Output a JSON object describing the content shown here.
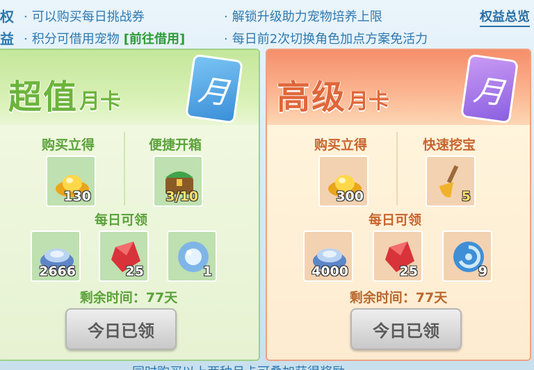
{
  "top": {
    "edge": [
      "权",
      "益"
    ],
    "perks": [
      "可以购买每日挑战券",
      "解锁升级助力宠物培养上限",
      "积分可借用宠物",
      "每日前2次切换角色加点方案免活力"
    ],
    "borrow_link": "[前往借用]",
    "summary_link": "权益总览"
  },
  "cards": [
    {
      "title_big": "超值",
      "title_small": "月卡",
      "emblem_glyph": "月",
      "section_left": "购买立得",
      "section_right": "便捷开箱",
      "instant": [
        {
          "icon": "gold-ingot-icon",
          "qty": "130"
        }
      ],
      "bonus": [
        {
          "icon": "treasure-chest-icon",
          "qty": "3/10"
        }
      ],
      "daily_title": "每日可领",
      "daily": [
        {
          "icon": "silver-ingot-icon",
          "qty": "2666"
        },
        {
          "icon": "red-crystal-icon",
          "qty": "25"
        },
        {
          "icon": "blue-orb-icon",
          "qty": "1"
        }
      ],
      "remaining": "剩余时间：77天",
      "claim_label": "今日已领",
      "accent": "#6cb43c"
    },
    {
      "title_big": "高级",
      "title_small": "月卡",
      "emblem_glyph": "月",
      "section_left": "购买立得",
      "section_right": "快速挖宝",
      "instant": [
        {
          "icon": "gold-ingot-icon",
          "qty": "300"
        }
      ],
      "bonus": [
        {
          "icon": "shovel-icon",
          "qty": "5"
        }
      ],
      "daily_title": "每日可领",
      "daily": [
        {
          "icon": "silver-ingot-icon",
          "qty": "4000"
        },
        {
          "icon": "red-crystal-icon",
          "qty": "25"
        },
        {
          "icon": "swirl-orb-icon",
          "qty": "9"
        }
      ],
      "remaining": "剩余时间：77天",
      "claim_label": "今日已领",
      "accent": "#e0663a"
    }
  ],
  "footer_note": "同时购买以上两种月卡可叠加获得奖励"
}
